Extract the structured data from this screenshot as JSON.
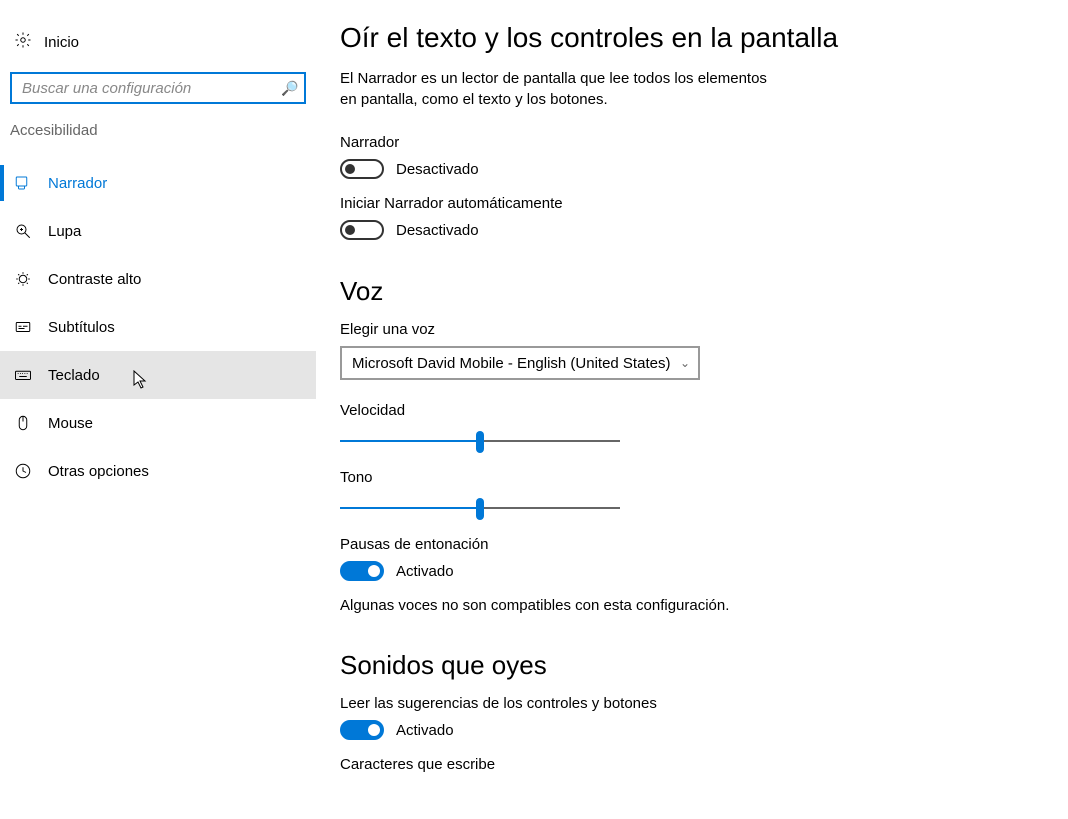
{
  "sidebar": {
    "home_label": "Inicio",
    "search_placeholder": "Buscar una configuración",
    "section_title": "Accesibilidad",
    "items": [
      {
        "id": "narrador",
        "label": "Narrador",
        "icon": "narrator-icon",
        "active": true,
        "hover": false
      },
      {
        "id": "lupa",
        "label": "Lupa",
        "icon": "magnifier-icon",
        "active": false,
        "hover": false
      },
      {
        "id": "contraste",
        "label": "Contraste alto",
        "icon": "contrast-icon",
        "active": false,
        "hover": false
      },
      {
        "id": "subtitulos",
        "label": "Subtítulos",
        "icon": "captions-icon",
        "active": false,
        "hover": false
      },
      {
        "id": "teclado",
        "label": "Teclado",
        "icon": "keyboard-icon",
        "active": false,
        "hover": true
      },
      {
        "id": "mouse",
        "label": "Mouse",
        "icon": "mouse-icon",
        "active": false,
        "hover": false
      },
      {
        "id": "otras",
        "label": "Otras opciones",
        "icon": "other-icon",
        "active": false,
        "hover": false
      }
    ]
  },
  "main": {
    "h1": "Oír el texto y los controles en la pantalla",
    "intro": "El Narrador es un lector de pantalla que lee todos los elementos en pantalla, como el texto y los botones.",
    "narrator_label": "Narrador",
    "narrator_state": "Desactivado",
    "auto_label": "Iniciar Narrador automáticamente",
    "auto_state": "Desactivado",
    "voice_h2": "Voz",
    "choose_voice_label": "Elegir una voz",
    "voice_selected": "Microsoft David Mobile - English (United States)",
    "speed_label": "Velocidad",
    "tone_label": "Tono",
    "pauses_label": "Pausas de entonación",
    "pauses_state": "Activado",
    "voice_note": "Algunas voces no son compatibles con esta configuración.",
    "sounds_h2": "Sonidos que oyes",
    "read_hints_label": "Leer las sugerencias de los controles y botones",
    "read_hints_state": "Activado",
    "chars_label": "Caracteres que escribe",
    "sliders": {
      "speed_pct": 50,
      "tone_pct": 50
    }
  },
  "colors": {
    "accent": "#0078d7"
  }
}
